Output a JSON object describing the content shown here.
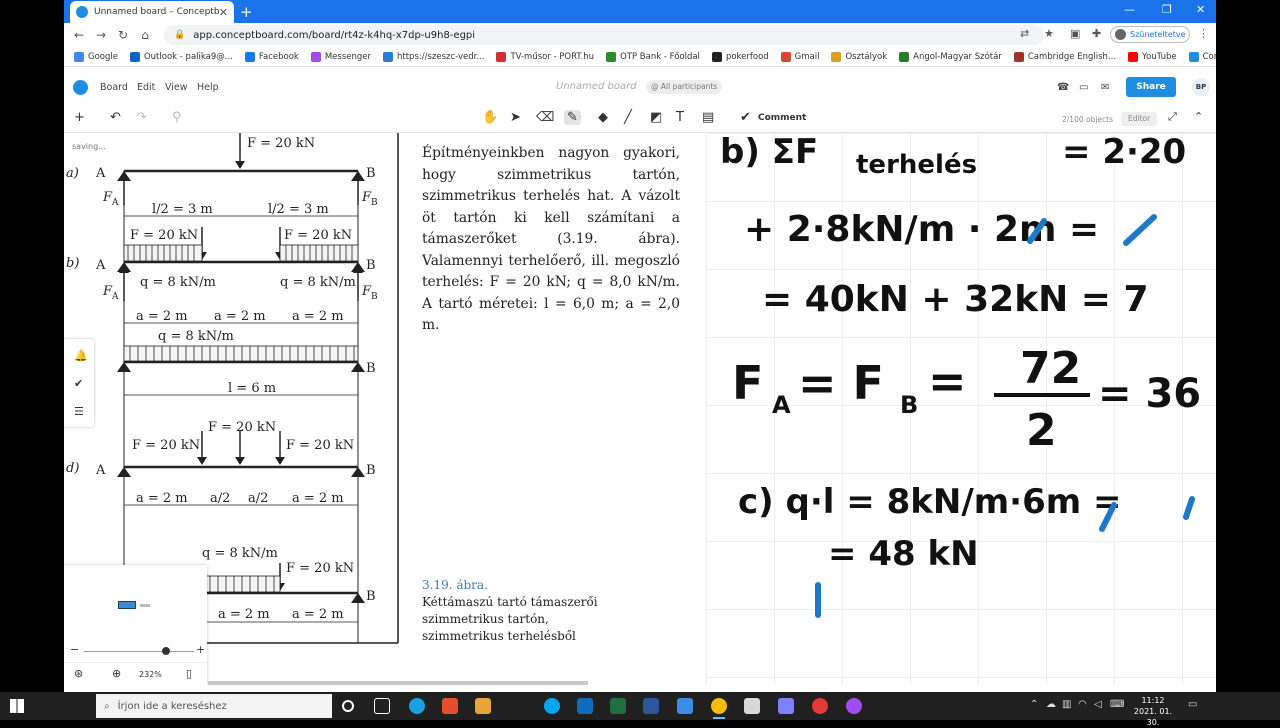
{
  "browser": {
    "tab_title": "Unnamed board – Conceptboard",
    "url": "app.conceptboard.com/board/rt4z-k4hq-x7dp-u9h8-egpi",
    "profile_label": "Szüneteltetve",
    "bookmarks": [
      "Google",
      "Outlook - palika9@...",
      "Facebook",
      "Messenger",
      "https://szeszc-vedr...",
      "TV-műsor - PORT.hu",
      "OTP Bank - Főoldal",
      "pokerfood",
      "Gmail",
      "Osztályok",
      "Angol-Magyar Szótár",
      "Cambridge English...",
      "YouTube",
      "Conceptboard"
    ],
    "bookmark_colors": [
      "#4285f4",
      "#0a64c8",
      "#1877f2",
      "#a04cf0",
      "#2a7bd4",
      "#d03030",
      "#2d8a2d",
      "#222222",
      "#db4437",
      "#d4a020",
      "#2b7a2b",
      "#a0322b",
      "#ff0000",
      "#1f8ee0"
    ]
  },
  "board": {
    "menu": [
      "Board",
      "Edit",
      "View",
      "Help"
    ],
    "name": "Unnamed board",
    "participants": "@ All participants",
    "share_label": "Share",
    "avatar": "BP",
    "comment_label": "Comment",
    "objects": "2/100 objects",
    "role": "Editor",
    "saving": "saving..."
  },
  "textbook": {
    "paragraph": "Építményeinkben nagyon gyakori, hogy szimmetrikus tartón, szimmetrikus terhelés hat. A vázolt öt tartón ki kell számítani a támaszerőket (3.19. ábra). Valamennyi terhelőerő, ill. megoszló terhelés: F = 20 kN; q = 8,0 kN/m. A tartó méretei: l = 6,0 m; a = 2,0 m.",
    "caption_title": "3.19. ábra.",
    "caption_line1": "Kéttámaszú tartó támaszerői",
    "caption_line2": "szimmetrikus tartón,",
    "caption_line3": "szimmetrikus terhelésből",
    "diagram_labels": {
      "a_label": "a)",
      "b_label": "b)",
      "d_label": "d)",
      "A": "A",
      "B": "B",
      "FA": "F",
      "FA_sub": "A",
      "FB": "F",
      "FB_sub": "B",
      "F20": "F = 20 kN",
      "l2": "l/2 = 3 m",
      "q8": "q = 8 kN/m",
      "a2": "a = 2 m",
      "a_half": "a/2",
      "l6": "l = 6 m",
      "F_partial": "F = 20 kN"
    }
  },
  "handwriting": {
    "line1": "b) ΣF",
    "line1_sub": "terhelés",
    "line1_end": "= 2·20",
    "line2": "+ 2·8kN/m · 2m =",
    "line3": "= 40kN + 32kN = 7",
    "line4_left": "F",
    "line4_sub1": "A",
    "line4_mid": "= F",
    "line4_sub2": "B",
    "line4_arrow": "=",
    "frac_num": "72",
    "frac_den": "2",
    "line4_end": "= 36",
    "line5": "c)  q·l = 8kN/m·6m =",
    "line6": "= 48 kN",
    "ink": "#111111",
    "accent": "#1e78c8"
  },
  "minimap": {
    "zoom": "232%"
  },
  "taskbar": {
    "search_placeholder": "Írjon ide a kereséshez",
    "time": "11:12",
    "date": "2021. 01. 30."
  }
}
